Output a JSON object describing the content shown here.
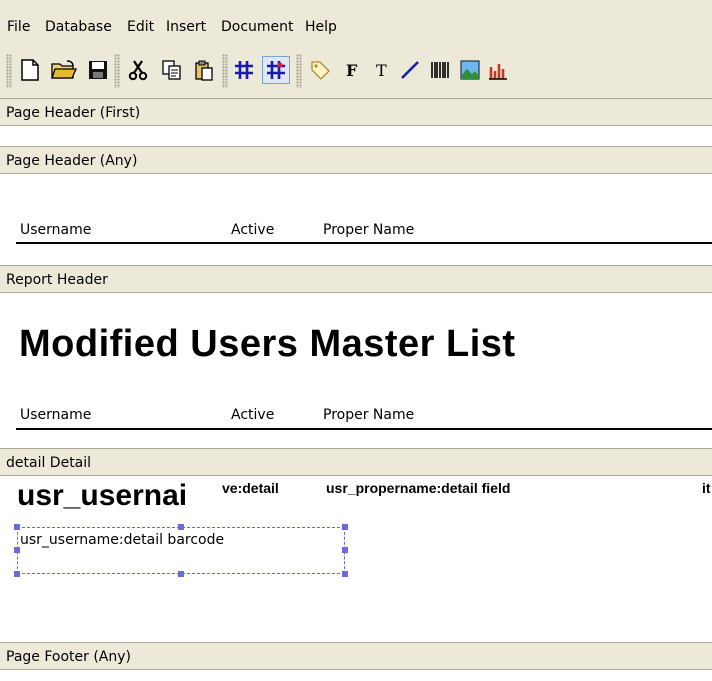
{
  "menu": {
    "items": [
      "File",
      "Database",
      "Edit",
      "Insert",
      "Document",
      "Help"
    ]
  },
  "toolbar": {
    "buttons": [
      {
        "name": "new-document-icon"
      },
      {
        "name": "open-folder-icon"
      },
      {
        "name": "save-disk-icon"
      },
      {
        "name": "cut-scissors-icon"
      },
      {
        "name": "copy-icon"
      },
      {
        "name": "paste-icon"
      },
      {
        "name": "grid-icon"
      },
      {
        "name": "snap-to-grid-icon",
        "active": true
      },
      {
        "name": "label-tag-icon"
      },
      {
        "name": "field-bold-f-icon"
      },
      {
        "name": "text-t-icon"
      },
      {
        "name": "line-draw-icon"
      },
      {
        "name": "barcode-icon"
      },
      {
        "name": "image-icon"
      },
      {
        "name": "chart-icon"
      }
    ]
  },
  "sections": {
    "page_header_first": "Page Header (First)",
    "page_header_any": "Page Header (Any)",
    "report_header": "Report Header",
    "detail": "detail Detail",
    "page_footer_any": "Page Footer (Any)"
  },
  "page_header_columns": {
    "username": "Username",
    "active": "Active",
    "proper_name": "Proper Name"
  },
  "report_header": {
    "title": "Modified Users Master List",
    "columns": {
      "username": "Username",
      "active": "Active",
      "proper_name": "Proper Name"
    }
  },
  "detail": {
    "username_field": "usr_usernai",
    "active_field": "ve:detail",
    "propername_field": "usr_propername:detail field",
    "extra_field": "it",
    "barcode_label": "usr_username:detail barcode"
  },
  "colors": {
    "chrome": "#ece9d8",
    "selection": "#6a6ad8"
  }
}
